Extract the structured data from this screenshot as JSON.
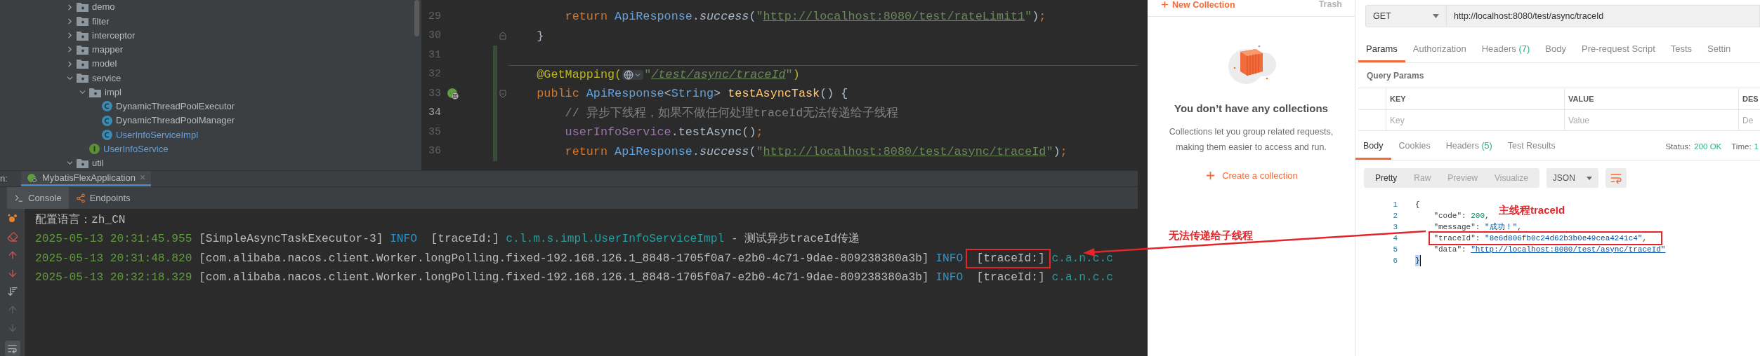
{
  "project_tree": {
    "items": [
      {
        "kind": "folder",
        "label": "demo",
        "expanded": false,
        "modified": false
      },
      {
        "kind": "folder",
        "label": "filter",
        "expanded": false,
        "modified": false
      },
      {
        "kind": "folder",
        "label": "interceptor",
        "expanded": false,
        "modified": false
      },
      {
        "kind": "folder",
        "label": "mapper",
        "expanded": false,
        "modified": false
      },
      {
        "kind": "folder",
        "label": "model",
        "expanded": false,
        "modified": false
      },
      {
        "kind": "folder",
        "label": "service",
        "expanded": true,
        "modified": false,
        "children": [
          {
            "kind": "folder",
            "label": "impl",
            "expanded": true,
            "modified": false,
            "children": [
              {
                "kind": "class",
                "label": "DynamicThreadPoolExecutor",
                "modified": false
              },
              {
                "kind": "class",
                "label": "DynamicThreadPoolManager",
                "modified": false
              },
              {
                "kind": "class",
                "label": "UserInfoServiceImpl",
                "modified": true
              }
            ]
          },
          {
            "kind": "interface",
            "label": "UserInfoService",
            "modified": true
          }
        ]
      },
      {
        "kind": "folder",
        "label": "util",
        "expanded": true,
        "modified": false
      }
    ]
  },
  "editor": {
    "lines": [
      {
        "number": "29",
        "current": false,
        "changed": false,
        "separator": false,
        "fold_start": false,
        "fold_end": false,
        "endpoint": false,
        "tokens": [
          {
            "kind": "keyword",
            "text": "        return "
          },
          {
            "kind": "type",
            "text": "ApiResponse"
          },
          {
            "kind": "plain",
            "text": "."
          },
          {
            "kind": "italic",
            "text": "success"
          },
          {
            "kind": "plain",
            "text": "("
          },
          {
            "kind": "string",
            "text": "\""
          },
          {
            "kind": "link",
            "text": "http://localhost:8080/test/rateLimit1"
          },
          {
            "kind": "string",
            "text": "\""
          },
          {
            "kind": "plain",
            "text": ")"
          },
          {
            "kind": "punct",
            "text": ";"
          }
        ]
      },
      {
        "number": "30",
        "current": false,
        "changed": false,
        "separator": false,
        "fold_start": false,
        "fold_end": true,
        "endpoint": false,
        "tokens": [
          {
            "kind": "plain",
            "text": "    }"
          }
        ]
      },
      {
        "number": "31",
        "current": false,
        "changed": true,
        "separator": false,
        "fold_start": false,
        "fold_end": false,
        "endpoint": false
      },
      {
        "number": "32",
        "current": false,
        "changed": true,
        "separator": true,
        "fold_start": false,
        "fold_end": false,
        "endpoint": false,
        "tokens": [
          {
            "kind": "annotation",
            "text": "    @GetMapping("
          },
          {
            "kind": "web-icon"
          },
          {
            "kind": "string",
            "text": "\""
          },
          {
            "kind": "link-italic",
            "text": "/test/async/traceId"
          },
          {
            "kind": "string",
            "text": "\""
          },
          {
            "kind": "annotation",
            "text": ")"
          }
        ]
      },
      {
        "number": "33",
        "current": false,
        "changed": true,
        "separator": false,
        "fold_start": true,
        "fold_end": false,
        "endpoint": true,
        "tokens": [
          {
            "kind": "keyword",
            "text": "    public "
          },
          {
            "kind": "type",
            "text": "ApiResponse"
          },
          {
            "kind": "plain",
            "text": "<"
          },
          {
            "kind": "type",
            "text": "String"
          },
          {
            "kind": "plain",
            "text": "> "
          },
          {
            "kind": "method",
            "text": "testAsyncTask"
          },
          {
            "kind": "plain",
            "text": "() {"
          }
        ]
      },
      {
        "number": "34",
        "current": true,
        "changed": true,
        "separator": false,
        "fold_start": false,
        "fold_end": false,
        "endpoint": false,
        "tokens": [
          {
            "kind": "comment",
            "text": "        // 异步下线程，如果不做任何处理traceId无法传递给子线程"
          }
        ]
      },
      {
        "number": "35",
        "current": false,
        "changed": true,
        "separator": false,
        "fold_start": false,
        "fold_end": false,
        "endpoint": false,
        "tokens": [
          {
            "kind": "field",
            "text": "        userInfoService"
          },
          {
            "kind": "plain",
            "text": ".testAsync()"
          },
          {
            "kind": "punct",
            "text": ";"
          }
        ]
      },
      {
        "number": "36",
        "current": false,
        "changed": true,
        "separator": false,
        "fold_start": false,
        "fold_end": false,
        "endpoint": false,
        "tokens": [
          {
            "kind": "keyword",
            "text": "        return "
          },
          {
            "kind": "type",
            "text": "ApiResponse"
          },
          {
            "kind": "plain",
            "text": "."
          },
          {
            "kind": "italic",
            "text": "success"
          },
          {
            "kind": "plain",
            "text": "("
          },
          {
            "kind": "string",
            "text": "\""
          },
          {
            "kind": "link",
            "text": "http://localhost:8080/test/async/traceId"
          },
          {
            "kind": "string",
            "text": "\""
          },
          {
            "kind": "plain",
            "text": ")"
          },
          {
            "kind": "punct",
            "text": ";"
          }
        ]
      }
    ]
  },
  "run_panel": {
    "label": "n:",
    "tab": {
      "label": "MybatisFlexApplication",
      "close": "×"
    },
    "tool_tabs": [
      {
        "label": "Console",
        "selected": true
      },
      {
        "label": "Endpoints",
        "selected": false
      }
    ]
  },
  "console": {
    "lines": [
      {
        "segments": [
          {
            "kind": "text",
            "text": "配置语言：zh_CN",
            "boxed": false
          }
        ]
      },
      {
        "segments": [
          {
            "kind": "time",
            "text": "2025-05-13 20:31:45.955",
            "boxed": false
          },
          {
            "kind": "text",
            "text": " [SimpleAsyncTaskExecutor-3] ",
            "boxed": false
          },
          {
            "kind": "level",
            "text": "INFO  ",
            "boxed": false
          },
          {
            "kind": "text",
            "text": "[traceId:]",
            "boxed": false
          },
          {
            "kind": "logger",
            "text": " c.l.m.s.impl.UserInfoServiceImpl",
            "boxed": false
          },
          {
            "kind": "text",
            "text": " - 测试异步traceId传递",
            "boxed": false
          }
        ]
      },
      {
        "segments": [
          {
            "kind": "time",
            "text": "2025-05-13 20:31:48.820",
            "boxed": false
          },
          {
            "kind": "text",
            "text": " [com.alibaba.nacos.client.Worker.longPolling.fixed-192.168.126.1_8848-1705f0a7-e2b0-4c71-9dae-809238380a3b] ",
            "boxed": false
          },
          {
            "kind": "level",
            "text": "INFO  ",
            "boxed": false
          },
          {
            "kind": "text",
            "text": "[traceId:]",
            "boxed": true
          },
          {
            "kind": "logger",
            "text": " c.a.n.c.c",
            "boxed": false
          }
        ]
      },
      {
        "segments": [
          {
            "kind": "time",
            "text": "2025-05-13 20:32:18.329",
            "boxed": false
          },
          {
            "kind": "text",
            "text": " [com.alibaba.nacos.client.Worker.longPolling.fixed-192.168.126.1_8848-1705f0a7-e2b0-4c71-9dae-809238380a3b] ",
            "boxed": false
          },
          {
            "kind": "level",
            "text": "INFO  ",
            "boxed": false
          },
          {
            "kind": "text",
            "text": "[traceId:]",
            "boxed": false
          },
          {
            "kind": "logger",
            "text": " c.a.n.c.c",
            "boxed": false
          }
        ]
      }
    ]
  },
  "postman": {
    "sidebar": {
      "new_collection": "New Collection",
      "trash": "Trash",
      "empty_title": "You don’t have any collections",
      "empty_text": "Collections let you group related requests, making them easier to access and run.",
      "create": "Create a collection"
    },
    "request": {
      "method": "GET",
      "url": "http://localhost:8080/test/async/traceId"
    },
    "request_tabs": [
      {
        "label": "Params",
        "selected": true
      },
      {
        "label": "Authorization",
        "selected": false
      },
      {
        "label": "Headers",
        "count": "(7)",
        "selected": false
      },
      {
        "label": "Body",
        "selected": false
      },
      {
        "label": "Pre-request Script",
        "selected": false
      },
      {
        "label": "Tests",
        "selected": false
      },
      {
        "label": "Settin",
        "selected": false
      }
    ],
    "query_params": {
      "title": "Query Params",
      "columns": [
        "KEY",
        "VALUE",
        "DES"
      ],
      "placeholders": [
        "Key",
        "Value",
        "De"
      ]
    },
    "response_tabs": [
      {
        "label": "Body",
        "selected": true
      },
      {
        "label": "Cookies",
        "selected": false
      },
      {
        "label": "Headers",
        "count": "(5)",
        "selected": false
      },
      {
        "label": "Test Results",
        "selected": false
      }
    ],
    "status": {
      "label": "Status:",
      "value": "200 OK"
    },
    "time": {
      "label": "Time:",
      "value": "1"
    },
    "view_modes": [
      {
        "label": "Pretty",
        "selected": true
      },
      {
        "label": "Raw",
        "selected": false
      },
      {
        "label": "Preview",
        "selected": false
      },
      {
        "label": "Visualize",
        "selected": false
      }
    ],
    "format": "JSON",
    "body_lines": [
      {
        "number": "1",
        "boxed": false,
        "cursor": false,
        "tokens": [
          {
            "kind": "punct",
            "text": "{"
          }
        ]
      },
      {
        "number": "2",
        "boxed": false,
        "cursor": false,
        "tokens": [
          {
            "kind": "key",
            "text": "    \"code\""
          },
          {
            "kind": "punct",
            "text": ": "
          },
          {
            "kind": "number",
            "text": "200"
          },
          {
            "kind": "punct",
            "text": ","
          }
        ]
      },
      {
        "number": "3",
        "boxed": false,
        "cursor": false,
        "tokens": [
          {
            "kind": "key",
            "text": "    \"message\""
          },
          {
            "kind": "punct",
            "text": ": "
          },
          {
            "kind": "string",
            "text": "\"成功！\""
          },
          {
            "kind": "punct",
            "text": ","
          }
        ]
      },
      {
        "number": "4",
        "boxed": true,
        "cursor": false,
        "tokens": [
          {
            "kind": "key",
            "text": "    \"traceId\""
          },
          {
            "kind": "punct",
            "text": ": "
          },
          {
            "kind": "string",
            "text": "\"8e6d806fb0c24d62b3b0e49cea4241c4\""
          },
          {
            "kind": "punct",
            "text": ","
          }
        ]
      },
      {
        "number": "5",
        "boxed": false,
        "cursor": false,
        "tokens": [
          {
            "kind": "key",
            "text": "    \"data\""
          },
          {
            "kind": "punct",
            "text": ": "
          },
          {
            "kind": "link",
            "text": "\"http://localhost:8080/test/async/traceId\""
          }
        ]
      },
      {
        "number": "6",
        "boxed": false,
        "cursor": true,
        "tokens": [
          {
            "kind": "punct",
            "text": "}"
          }
        ]
      }
    ]
  },
  "annotations": [
    {
      "text": "无法传递给子线程"
    },
    {
      "text": "主线程traceId"
    }
  ]
}
